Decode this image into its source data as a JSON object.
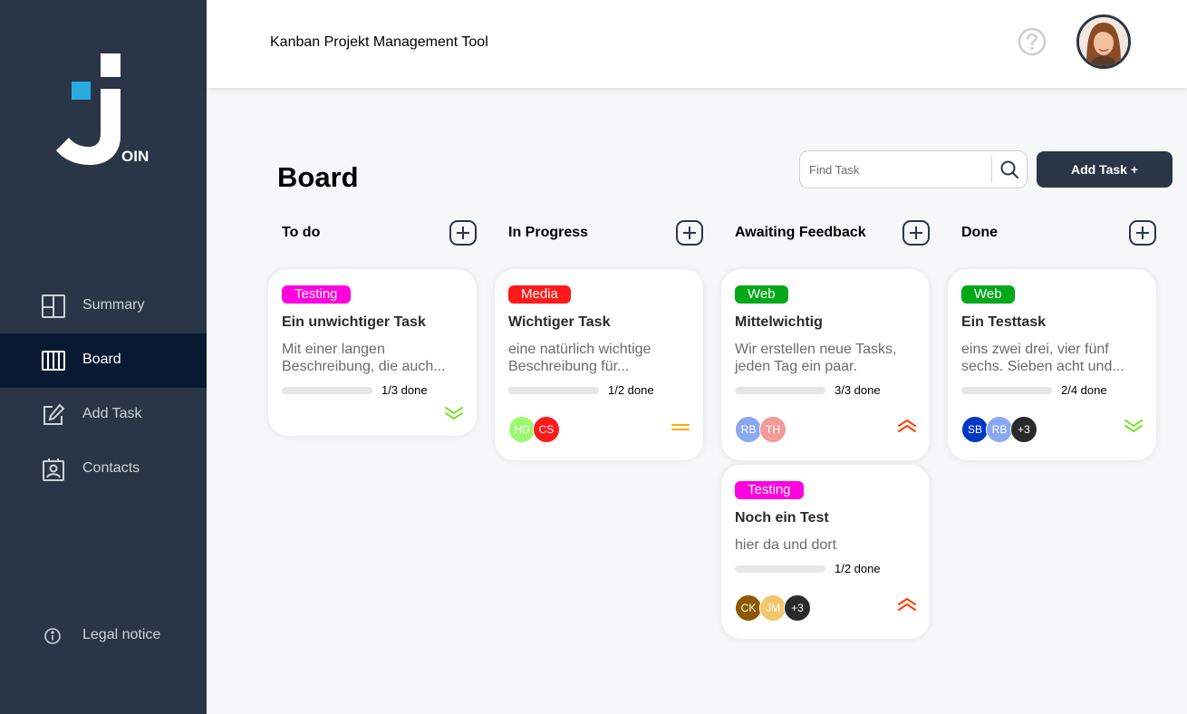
{
  "app": {
    "header_title": "Kanban Projekt Management Tool",
    "logo_text": "OIN"
  },
  "nav": {
    "items": [
      {
        "label": "Summary"
      },
      {
        "label": "Board"
      },
      {
        "label": "Add Task"
      },
      {
        "label": "Contacts"
      }
    ],
    "legal": "Legal notice"
  },
  "board": {
    "title": "Board",
    "search_placeholder": "Find Task",
    "add_task_label": "Add Task +"
  },
  "columns": [
    {
      "title": "To do"
    },
    {
      "title": "In Progress"
    },
    {
      "title": "Awaiting Feedback"
    },
    {
      "title": "Done"
    }
  ],
  "cards": [
    {
      "tag": "Testing",
      "tag_color": "#ff00de",
      "title": "Ein unwichtiger Task",
      "desc": "Mit einer langen Beschreibung, die auch...",
      "progress": 0.33,
      "progress_color": "#ff00de",
      "progress_text": "1/3 done",
      "assignees": [],
      "priority": "low-icon"
    },
    {
      "tag": "Media",
      "tag_color": "#ff1a1a",
      "title": "Wichtiger Task",
      "desc": "eine natürlich wichtige Beschreibung für...",
      "progress": 0.5,
      "progress_color": "#ff1a1a",
      "progress_text": "1/2 done",
      "assignees": [
        {
          "initials": "HD",
          "color": "#9df871"
        },
        {
          "initials": "CS",
          "color": "#ff1a1a"
        }
      ],
      "priority": "medium-icon"
    },
    {
      "tag": "Web",
      "tag_color": "#00a81a",
      "title": "Mittelwichtig",
      "desc": "Wir erstellen neue Tasks, jeden Tag ein paar.",
      "progress": 1.0,
      "progress_color": "#00a81a",
      "progress_text": "3/3 done",
      "assignees": [
        {
          "initials": "RB",
          "color": "#8aa8f2"
        },
        {
          "initials": "TH",
          "color": "#f39b9b"
        }
      ],
      "priority": "urgent-icon"
    },
    {
      "tag": "Testing",
      "tag_color": "#ff00de",
      "title": "Noch ein Test",
      "desc": "hier da und dort",
      "progress": 0.5,
      "progress_color": "#ff00de",
      "progress_text": "1/2 done",
      "assignees": [
        {
          "initials": "CK",
          "color": "#8b5a00"
        },
        {
          "initials": "JM",
          "color": "#f5c76b"
        },
        {
          "initials": "+3",
          "color": "#2a2a2a"
        }
      ],
      "priority": "urgent-icon"
    },
    {
      "tag": "Web",
      "tag_color": "#00a81a",
      "title": "Ein Testtask",
      "desc": "eins zwei drei, vier fünf sechs. Sieben acht und...",
      "progress": 0.5,
      "progress_color": "#00a81a",
      "progress_text": "2/4 done",
      "assignees": [
        {
          "initials": "SB",
          "color": "#0038c6"
        },
        {
          "initials": "RB",
          "color": "#8aa8f2"
        },
        {
          "initials": "+3",
          "color": "#2a2a2a"
        }
      ],
      "priority": "low-icon"
    }
  ]
}
